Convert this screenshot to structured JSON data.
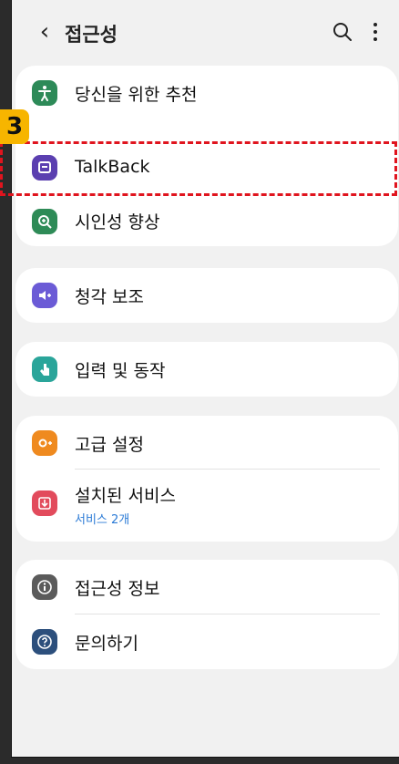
{
  "header": {
    "back_icon": "chevron-left-icon",
    "title": "접근성"
  },
  "groups": [
    {
      "items": [
        {
          "label": "당신을 위한 추천",
          "icon": "accessibility-person-icon",
          "color": "#2d8a58"
        },
        {
          "label": "TalkBack",
          "icon": "talkback-icon",
          "color": "#5b3fb0"
        },
        {
          "label": "시인성 향상",
          "icon": "magnifier-icon",
          "color": "#2e8b57"
        }
      ]
    },
    {
      "items": [
        {
          "label": "청각 보조",
          "icon": "hearing-icon",
          "color": "#6b5bd6"
        }
      ]
    },
    {
      "items": [
        {
          "label": "입력 및 동작",
          "icon": "touch-icon",
          "color": "#2aa59a"
        }
      ]
    },
    {
      "items": [
        {
          "label": "고급 설정",
          "icon": "gear-plus-icon",
          "color": "#ef8a1f"
        },
        {
          "label": "설치된 서비스",
          "sub": "서비스 2개",
          "icon": "download-icon",
          "color": "#e24b5c"
        }
      ]
    },
    {
      "items": [
        {
          "label": "접근성 정보",
          "icon": "info-icon",
          "color": "#5b5b5b"
        },
        {
          "label": "문의하기",
          "icon": "question-icon",
          "color": "#2c4f7c"
        }
      ]
    }
  ],
  "annotation": {
    "step_number": "3",
    "highlight_color": "#e0141e",
    "badge_color": "#f7b500"
  }
}
